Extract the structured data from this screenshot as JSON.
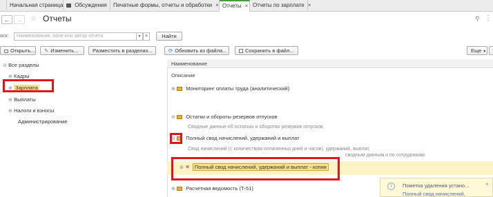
{
  "tabs": [
    {
      "label": "Начальная страница"
    },
    {
      "label": "Обсуждения"
    },
    {
      "label": "Печатные формы, отчеты и обработки",
      "close": "×"
    },
    {
      "label": "Отчеты",
      "close": "×"
    },
    {
      "label": "Отчеты по зарплате",
      "close": "×"
    }
  ],
  "page_title": "Отчеты",
  "search": {
    "label": "иск:",
    "placeholder": "Наименование, поле или автор отчета",
    "find_label": "Найти"
  },
  "toolbar": {
    "open": "Открыть...",
    "edit": "Изменить...",
    "place": "Разместить в разделах...",
    "update_file": "Обновить из файла...",
    "save_file": "Сохранить в файл...",
    "more": "Еще",
    "help": "?"
  },
  "tree": {
    "root": "Все разделы",
    "items": [
      "Кадры",
      "Зарплата",
      "Выплаты",
      "Налоги и взносы",
      "Администрирование"
    ]
  },
  "list": {
    "col_name": "Наименование",
    "col_desc": "Описание",
    "reports": [
      {
        "title": "Мониторинг оплаты труда (аналитический)"
      },
      {
        "title": "Остатки и обороты резервов отпусков",
        "desc": "Сводные данные об остатках и оборотах резервов отпусков."
      },
      {
        "title": "Полный свод начислений, удержаний и выплат",
        "desc": "Свод начислений (с количеством оплаченных дней и часов), удержаний, выплат,",
        "desc2": "сводным данным и по сотрудникам."
      },
      {
        "title": "Полный свод начислений, удержаний и выплат - копия"
      },
      {
        "title": "Расчетная ведомость (Т-51)"
      }
    ]
  },
  "notification": {
    "title": "Пометка удаления устано...",
    "link": "Полный свод начислений,",
    "close": "×"
  }
}
